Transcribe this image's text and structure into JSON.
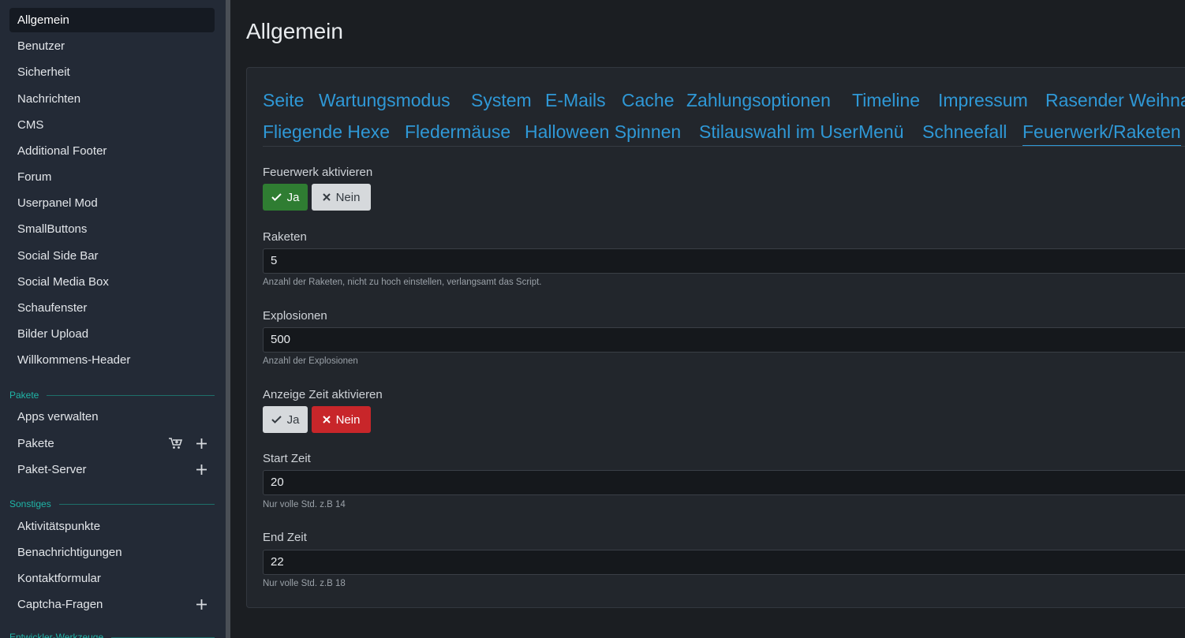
{
  "sidebar": {
    "items": [
      {
        "label": "Allgemein"
      },
      {
        "label": "Benutzer"
      },
      {
        "label": "Sicherheit"
      },
      {
        "label": "Nachrichten"
      },
      {
        "label": "CMS"
      },
      {
        "label": "Additional Footer"
      },
      {
        "label": "Forum"
      },
      {
        "label": "Userpanel Mod"
      },
      {
        "label": "SmallButtons"
      },
      {
        "label": "Social Side Bar"
      },
      {
        "label": "Social Media Box"
      },
      {
        "label": "Schaufenster"
      },
      {
        "label": "Bilder Upload"
      },
      {
        "label": "Willkommens-Header"
      }
    ],
    "section_pakete": "Pakete",
    "pakete_items": [
      {
        "label": "Apps verwalten"
      },
      {
        "label": "Pakete"
      },
      {
        "label": "Paket-Server"
      }
    ],
    "section_sonstiges": "Sonstiges",
    "sonstiges_items": [
      {
        "label": "Aktivitätspunkte"
      },
      {
        "label": "Benachrichtigungen"
      },
      {
        "label": "Kontaktformular"
      },
      {
        "label": "Captcha-Fragen"
      }
    ],
    "section_entwickler": "Entwickler-Werkzeuge"
  },
  "main": {
    "title": "Allgemein",
    "tabs_row1": [
      "Seite",
      "Wartungsmodus",
      "System",
      "E-Mails",
      "Cache",
      "Zahlungsoptionen",
      "Timeline",
      "Impressum",
      "Rasender Weihnachtsmann"
    ],
    "tabs_row2": [
      "Fliegende Hexe",
      "Fledermäuse",
      "Halloween Spinnen",
      "Stilauswahl im UserMenü",
      "Schneefall",
      "Feuerwerk/Raketen"
    ],
    "active_tab": "Feuerwerk/Raketen",
    "fields": {
      "feuerwerk": {
        "label": "Feuerwerk aktivieren",
        "yes": "Ja",
        "no": "Nein",
        "value": "Ja"
      },
      "raketen": {
        "label": "Raketen",
        "value": "5",
        "hint": "Anzahl der Raketen, nicht zu hoch einstellen, verlangsamt das Script."
      },
      "explosionen": {
        "label": "Explosionen",
        "value": "500",
        "hint": "Anzahl der Explosionen"
      },
      "anzeige_zeit": {
        "label": "Anzeige Zeit aktivieren",
        "yes": "Ja",
        "no": "Nein",
        "value": "Nein"
      },
      "start_zeit": {
        "label": "Start Zeit",
        "value": "20",
        "hint": "Nur volle Std. z.B 14"
      },
      "end_zeit": {
        "label": "End Zeit",
        "value": "22",
        "hint": "Nur volle Std. z.B 18"
      }
    }
  },
  "colors": {
    "sidebar_bg": "#232a36",
    "main_bg": "#1b1e22",
    "accent_link": "#2f98d6",
    "section_label": "#1fb5a7",
    "yes_active": "#2f7d32",
    "no_active": "#c8262a"
  }
}
